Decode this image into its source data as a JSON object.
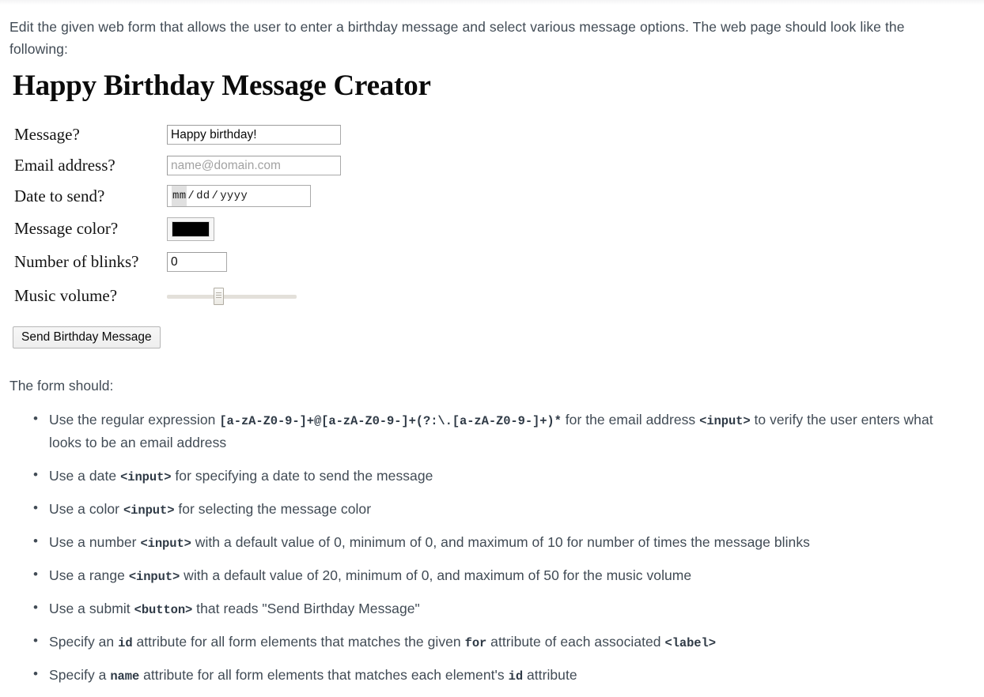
{
  "intro": {
    "paragraph": "Edit the given web form that allows the user to enter a birthday message and select various message options. The web page should look like the following:"
  },
  "demo_form": {
    "heading": "Happy Birthday Message Creator",
    "fields": [
      {
        "label": "Message?",
        "type": "text",
        "value": "Happy birthday!",
        "placeholder": ""
      },
      {
        "label": "Email address?",
        "type": "email",
        "value": "",
        "placeholder": "name@domain.com"
      },
      {
        "label": "Date to send?",
        "type": "date",
        "value": "",
        "placeholder": "mm/dd/yyyy",
        "segments": {
          "month": "mm",
          "day": "dd",
          "year": "yyyy",
          "separator": "/"
        }
      },
      {
        "label": "Message color?",
        "type": "color",
        "value": "#000000"
      },
      {
        "label": "Number of blinks?",
        "type": "number",
        "value": "0",
        "min": "0",
        "max": "10"
      },
      {
        "label": "Music volume?",
        "type": "range",
        "value": "20",
        "min": "0",
        "max": "50"
      }
    ],
    "submit_label": "Send Birthday Message"
  },
  "requirements": {
    "lead": "The form should:",
    "items": [
      {
        "parts": [
          {
            "text": "Use the regular expression ",
            "code": false
          },
          {
            "text": "[a-zA-Z0-9-]+@[a-zA-Z0-9-]+(?:\\.[a-zA-Z0-9-]+)*",
            "code": true
          },
          {
            "text": " for the email address ",
            "code": false
          },
          {
            "text": "<input>",
            "code": true
          },
          {
            "text": " to verify the user enters what looks to be an email address",
            "code": false
          }
        ]
      },
      {
        "parts": [
          {
            "text": "Use a date ",
            "code": false
          },
          {
            "text": "<input>",
            "code": true
          },
          {
            "text": " for specifying a date to send the message",
            "code": false
          }
        ]
      },
      {
        "parts": [
          {
            "text": "Use a color ",
            "code": false
          },
          {
            "text": "<input>",
            "code": true
          },
          {
            "text": " for selecting the message color",
            "code": false
          }
        ]
      },
      {
        "parts": [
          {
            "text": "Use a number ",
            "code": false
          },
          {
            "text": "<input>",
            "code": true
          },
          {
            "text": " with a default value of 0, minimum of 0, and maximum of 10 for number of times the message blinks",
            "code": false
          }
        ]
      },
      {
        "parts": [
          {
            "text": "Use a range ",
            "code": false
          },
          {
            "text": "<input>",
            "code": true
          },
          {
            "text": " with a default value of 20, minimum of 0, and maximum of 50 for the music volume",
            "code": false
          }
        ]
      },
      {
        "parts": [
          {
            "text": "Use a submit ",
            "code": false
          },
          {
            "text": "<button>",
            "code": true
          },
          {
            "text": " that reads \"Send Birthday Message\"",
            "code": false
          }
        ]
      },
      {
        "parts": [
          {
            "text": "Specify an ",
            "code": false
          },
          {
            "text": "id",
            "code": true
          },
          {
            "text": " attribute for all form elements that matches the given ",
            "code": false
          },
          {
            "text": "for",
            "code": true
          },
          {
            "text": " attribute of each associated ",
            "code": false
          },
          {
            "text": "<label>",
            "code": true
          }
        ]
      },
      {
        "parts": [
          {
            "text": "Specify a ",
            "code": false
          },
          {
            "text": "name",
            "code": true
          },
          {
            "text": " attribute for all form elements that matches each element's ",
            "code": false
          },
          {
            "text": "id",
            "code": true
          },
          {
            "text": " attribute",
            "code": false
          }
        ]
      }
    ]
  },
  "colors": {
    "body_text": "#414b55",
    "heading": "#0b0b0b",
    "code_text": "#2f3a46",
    "swatch": "#000000",
    "placeholder": "#a2a2a2"
  }
}
